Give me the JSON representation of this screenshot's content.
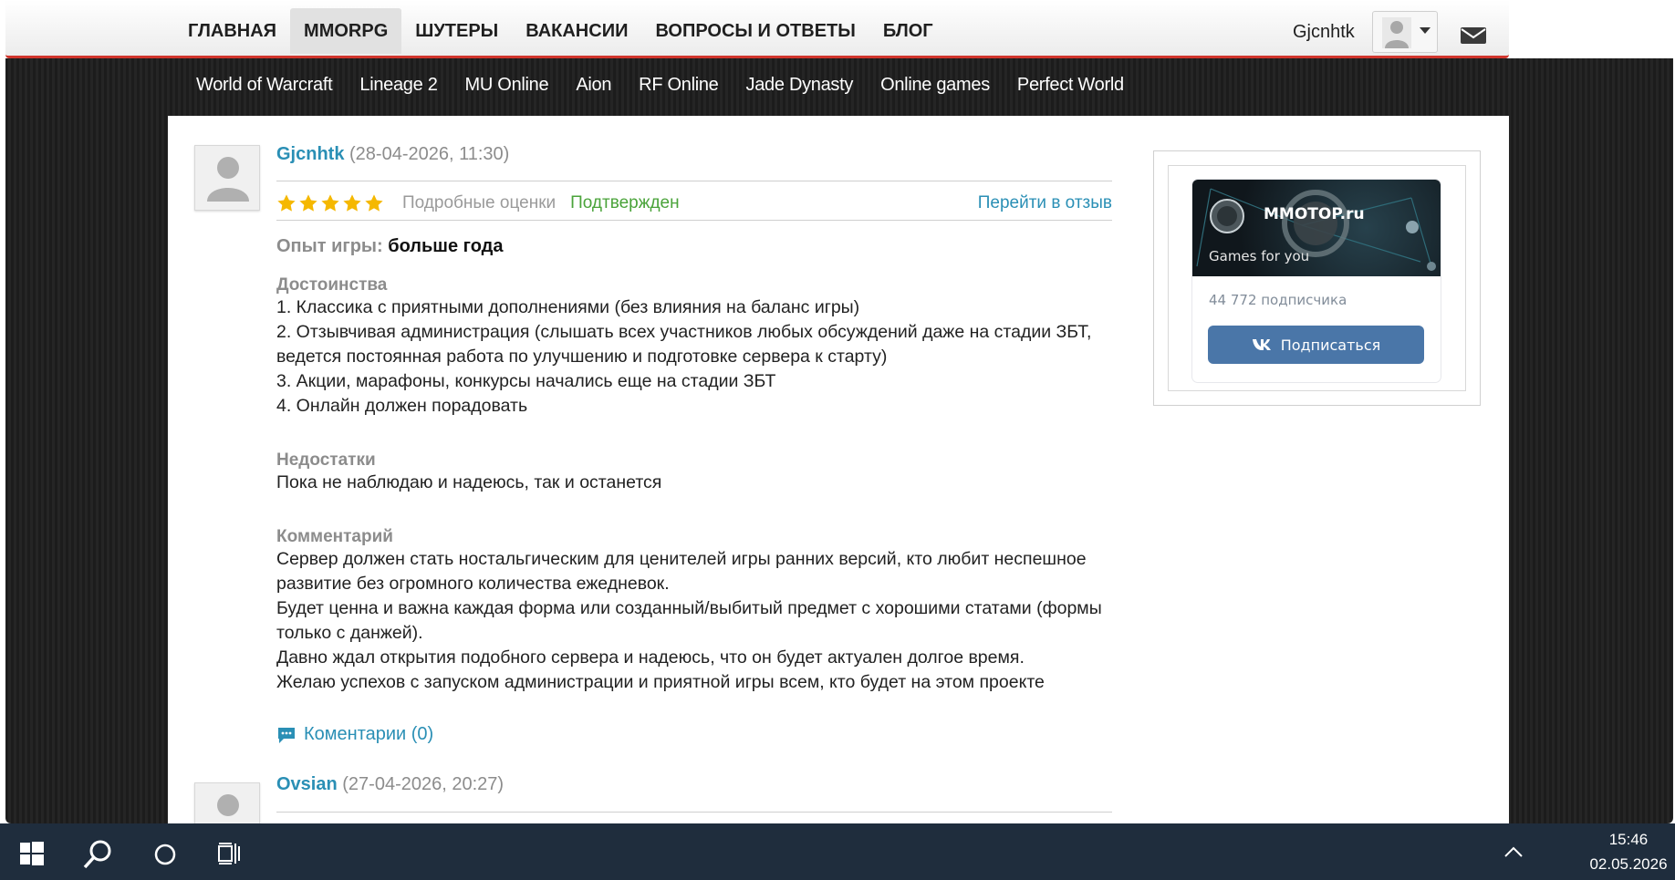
{
  "header": {
    "nav": [
      "ГЛАВНАЯ",
      "MMORPG",
      "ШУТЕРЫ",
      "ВАКАНСИИ",
      "ВОПРОСЫ И ОТВЕТЫ",
      "БЛОГ"
    ],
    "active_nav": "MMORPG",
    "username": "Gjcnhtk"
  },
  "subnav": [
    "World of Warcraft",
    "Lineage 2",
    "MU Online",
    "Aion",
    "RF Online",
    "Jade Dynasty",
    "Online games",
    "Perfect World"
  ],
  "review1": {
    "author": "Gjcnhtk",
    "date": "(28-04-2026, 11:30)",
    "stars": 5,
    "detailed_ratings": "Подробные оценки",
    "status": "Подтвержден",
    "goto": "Перейти в отзыв",
    "exp_label": "Опыт игры:",
    "exp_value": "больше года",
    "pros_title": "Достоинства",
    "pros": [
      "1. Классика с приятными дополнениями (без влияния на баланс игры)",
      "2. Отзывчивая администрация (слышать всех участников любых обсуждений даже на стадии ЗБТ,",
      "ведется постоянная работа по улучшению и подготовке сервера к старту)",
      "3. Акции, марафоны, конкурсы начались еще на стадии ЗБТ",
      "4. Онлайн должен порадовать"
    ],
    "cons_title": "Недостатки",
    "cons": [
      "Пока не наблюдаю и надеюсь, так и останется"
    ],
    "comment_title": "Комментарий",
    "comment": [
      "Сервер должен стать ностальгическим для ценителей игры ранних версий, кто любит неспешное",
      "развитие без огромного количества ежедневок.",
      "Будет ценна и важна каждая форма или созданный/выбитый предмет с хорошими статами (формы",
      "только с данжей).",
      "Давно ждал открытия подобного сервера и надеюсь, что он будет актуален долгое время.",
      "Желаю успехов с запуском администрации и приятной игры всем, кто будет на этом проекте"
    ],
    "comments_link": "Коментарии (0)"
  },
  "review2": {
    "author": "Ovsian",
    "date": "(27-04-2026, 20:27)"
  },
  "vk_widget": {
    "title": "MMOTOP.ru",
    "tagline": "Games for you",
    "subscribers": "44 772 подписчика",
    "subscribe": "Подписаться"
  },
  "taskbar": {
    "time": "15:46",
    "date": "02.05.2026"
  },
  "colors": {
    "accent_red": "#d0342c",
    "link_blue": "#2a8fb5",
    "confirmed_green": "#4aa33a",
    "star_yellow": "#f5b800",
    "vk_blue": "#4a76a8"
  }
}
